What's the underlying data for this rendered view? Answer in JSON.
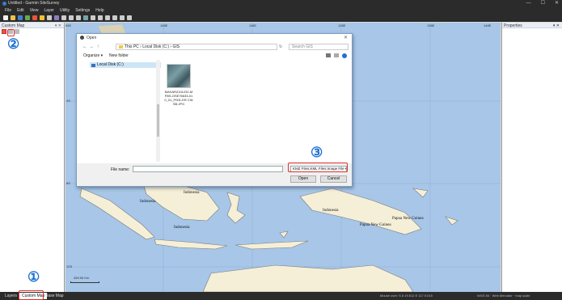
{
  "window": {
    "title": "Untitled - Garmin SiteSurvey",
    "minimize": "—",
    "maximize": "☐",
    "close": "✕"
  },
  "menu": [
    "File",
    "Edit",
    "View",
    "Layer",
    "Utility",
    "Settings",
    "Help"
  ],
  "left_panel": {
    "title": "Custom Map",
    "controls": "▾ ✕"
  },
  "right_panel": {
    "title": "Properties",
    "controls": "▾ ✕"
  },
  "bottom_tabs": [
    {
      "label": "Layers",
      "active": false
    },
    {
      "label": "Custom Map",
      "active": true
    },
    {
      "label": "Base Map",
      "active": false
    }
  ],
  "status": {
    "coords": "Mouse over: S 8 19.512 E 117 5.015",
    "projection": "WGS 84 · Web Mercator · map scale"
  },
  "markers": {
    "one": "①",
    "two": "②",
    "three": "③"
  },
  "map": {
    "labels": [
      "Indonesia",
      "Indonesia",
      "Indonesia",
      "Indonesia",
      "Papua New Guinea",
      "Papua New Guinea"
    ],
    "scale": "459.96 Km",
    "lon_ticks": [
      "98E",
      "108E",
      "118E",
      "128E",
      "138E",
      "148E"
    ],
    "lat_ticks": [
      "4S",
      "8S",
      "12S"
    ]
  },
  "dialog": {
    "title": "Open",
    "close": "✕",
    "nav": {
      "back": "←",
      "forward": "→",
      "up": "↑"
    },
    "breadcrumb": "This PC  ›  Local Disk (C:)  ›  GIS",
    "refresh": "↻",
    "search_placeholder": "Search GIS",
    "organize": "Organize ▾",
    "new_folder": "New folder",
    "nav_item": "Local Disk (C:)",
    "file_name": "MAXAR2101231-MFBS-OSE76633-010_01_P001-ER CWSB.JPG",
    "file_name_label": "File name:",
    "file_name_value": "",
    "filter": "KMZ Files;KML Files;Image File ▾",
    "open": "Open",
    "cancel": "Cancel"
  },
  "colors": {
    "accent": "#1a6fd4",
    "highlight_box": "#e03030",
    "sea": "#a7c6e8",
    "land": "#f5efd8"
  }
}
